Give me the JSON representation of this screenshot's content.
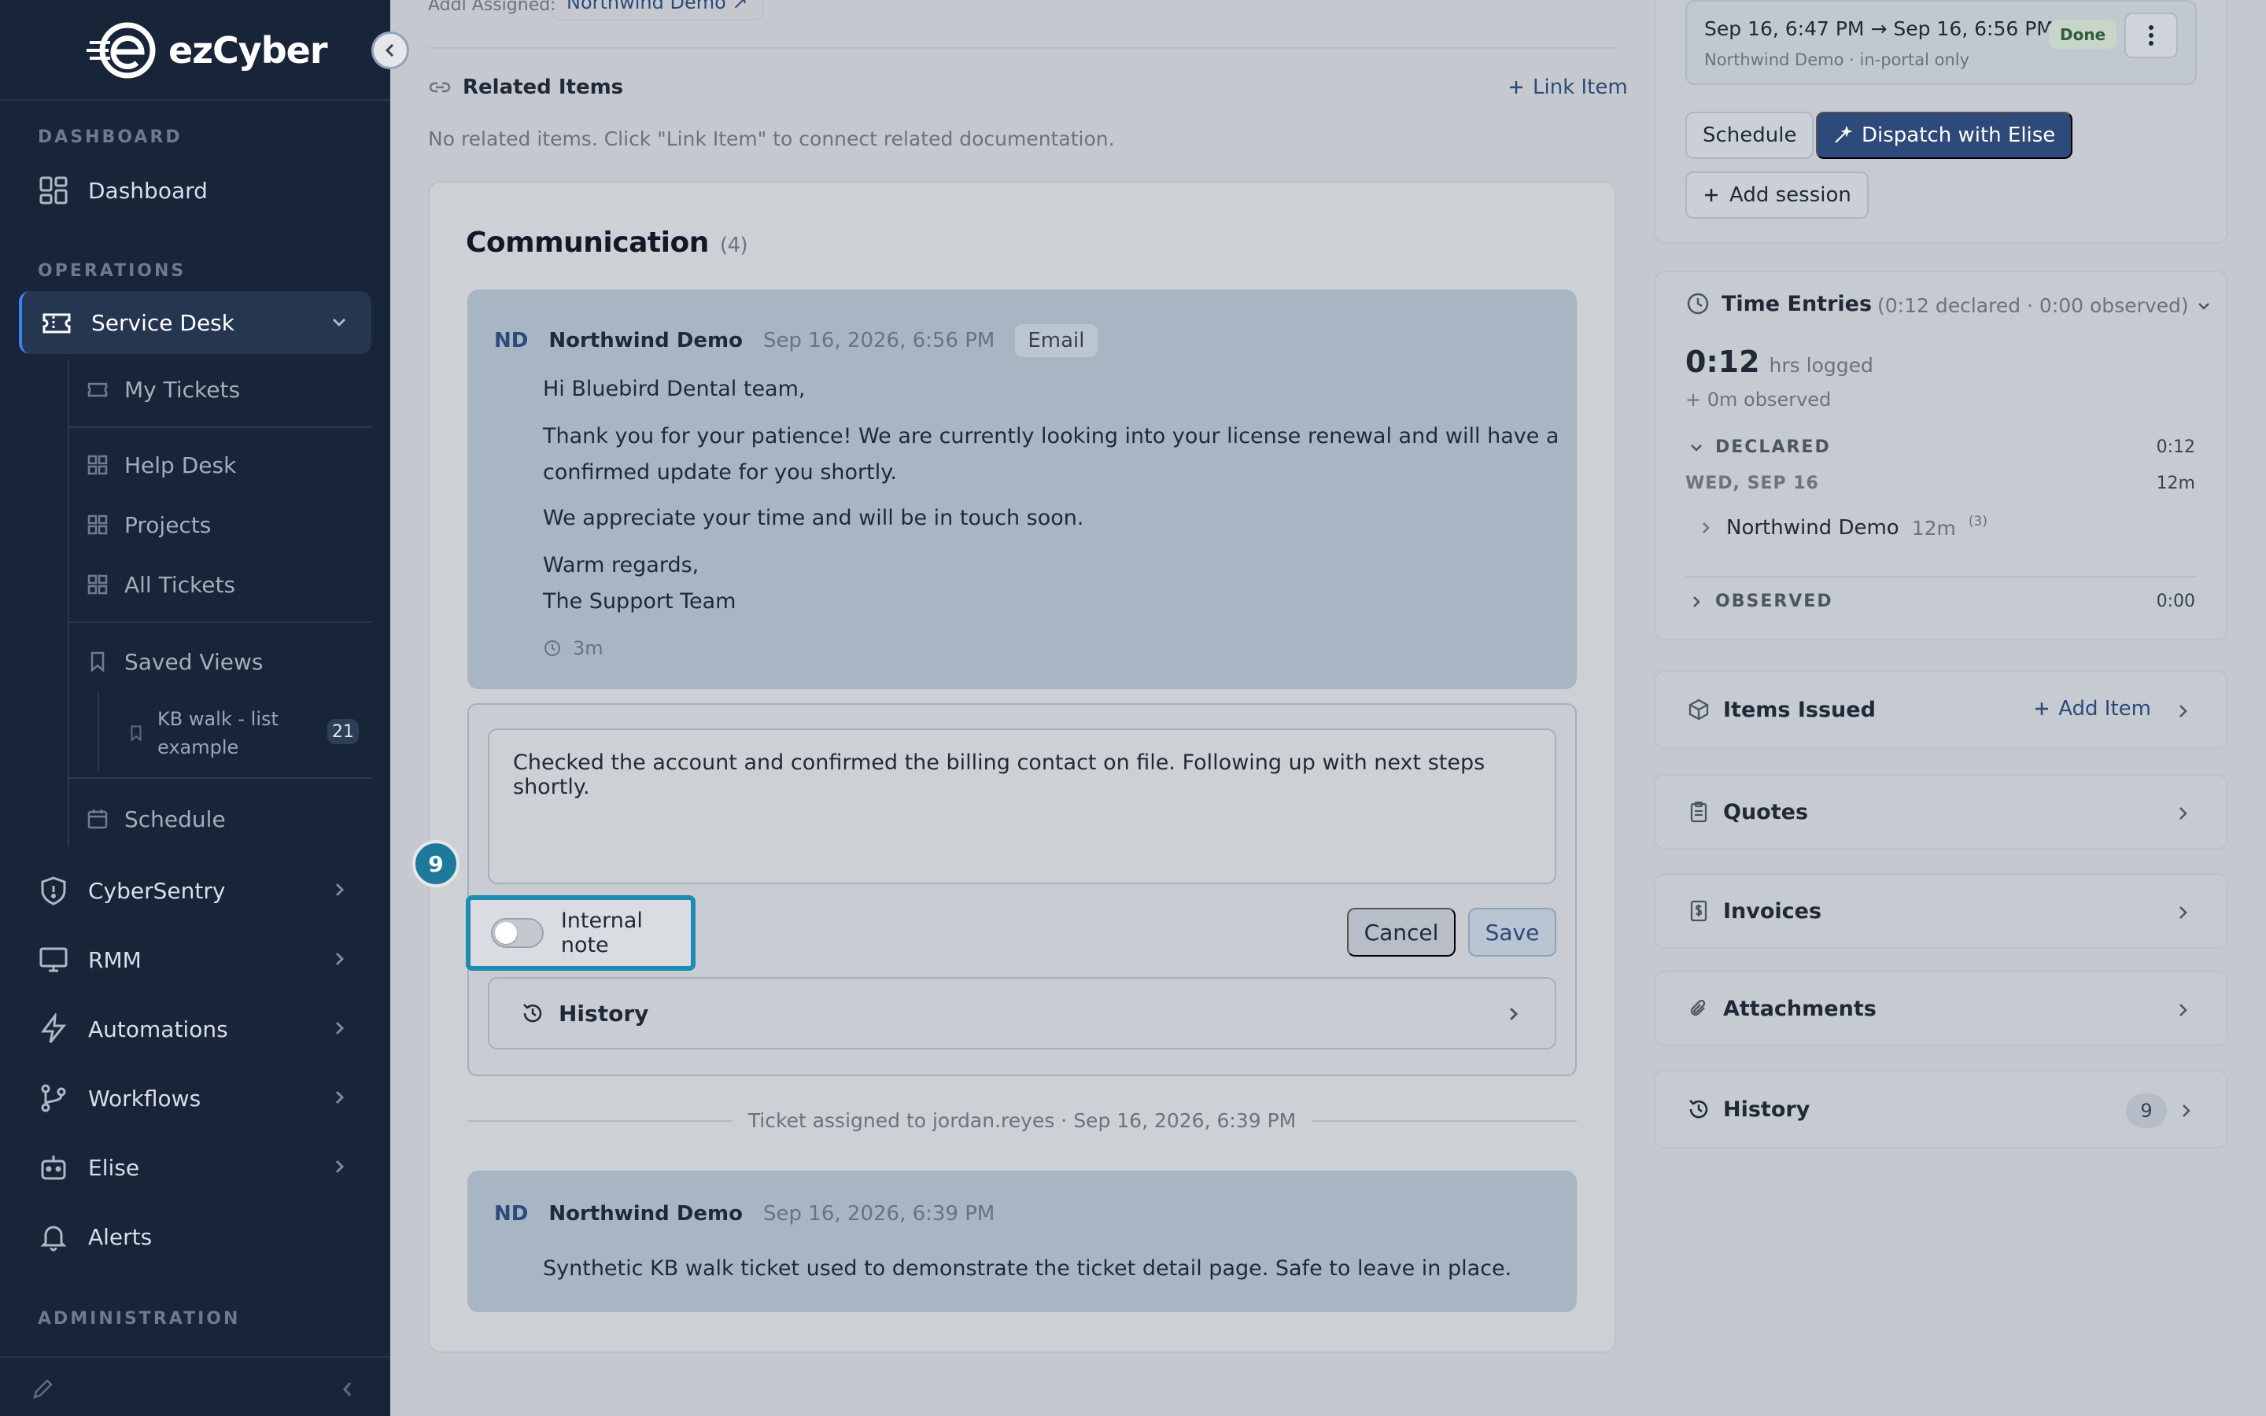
{
  "brand": {
    "logo_text": "ezCyber"
  },
  "sidebar": {
    "sections": {
      "dashboard": "DASHBOARD",
      "operations": "OPERATIONS",
      "administration": "ADMINISTRATION"
    },
    "items": {
      "dashboard": "Dashboard",
      "service_desk": "Service Desk",
      "cybersentry": "CyberSentry",
      "rmm": "RMM",
      "automations": "Automations",
      "workflows": "Workflows",
      "elise": "Elise",
      "alerts": "Alerts"
    },
    "sub_items": {
      "my_tickets": "My Tickets",
      "help_desk": "Help Desk",
      "projects": "Projects",
      "all_tickets": "All Tickets",
      "saved_views": "Saved Views",
      "saved_view_1": "KB walk - list example",
      "saved_view_1_count": "21",
      "schedule": "Schedule"
    }
  },
  "top": {
    "assigned_label": "Addl Assigned:",
    "assigned_value": "Northwind Demo ↗"
  },
  "related": {
    "title": "Related Items",
    "link_label": "Link Item",
    "empty_text": "No related items. Click \"Link Item\" to connect related documentation."
  },
  "communication": {
    "title": "Communication",
    "count": "(4)",
    "messages": [
      {
        "initials": "ND",
        "author": "Northwind Demo",
        "time": "Sep 16, 2026, 6:56 PM",
        "tag": "Email",
        "lines": [
          "Hi Bluebird Dental team,",
          "Thank you for your patience! We are currently looking into your license renewal and will have a",
          "confirmed update for you shortly.",
          "We appreciate your time and will be in touch soon.",
          "Warm regards,",
          "The Support Team"
        ],
        "duration": "3m"
      },
      {
        "initials": "ND",
        "author": "Northwind Demo",
        "time": "Sep 16, 2026, 6:39 PM",
        "body": "Synthetic KB walk ticket used to demonstrate the ticket detail page. Safe to leave in place."
      }
    ],
    "reply": {
      "text": "Checked the account and confirmed the billing contact on file. Following up with next steps shortly.",
      "internal_note_label": "Internal note",
      "internal_note_on": false,
      "cancel_label": "Cancel",
      "save_label": "Save",
      "history_label": "History"
    },
    "step_badge": "9",
    "system_event": "Ticket assigned to jordan.reyes · Sep 16, 2026, 6:39 PM"
  },
  "right": {
    "session": {
      "time_range": "Sep 16, 6:47 PM → Sep 16, 6:56 PM",
      "sub": "Northwind Demo · in-portal only",
      "status": "Done"
    },
    "buttons": {
      "schedule": "Schedule",
      "dispatch": "Dispatch with Elise",
      "add_session": "Add session"
    },
    "time_entries": {
      "title": "Time Entries",
      "summary": "(0:12 declared · 0:00 observed)",
      "total": "0:12",
      "total_unit": "hrs logged",
      "observed_note": "+ 0m observed",
      "declared_label": "DECLARED",
      "declared_value": "0:12",
      "date_label": "WED, SEP 16",
      "date_value": "12m",
      "entry_name": "Northwind Demo",
      "entry_duration": "12m",
      "entry_count": "(3)",
      "observed_label": "OBSERVED",
      "observed_value": "0:00"
    },
    "sections": {
      "items_issued": "Items Issued",
      "add_item": "Add Item",
      "quotes": "Quotes",
      "invoices": "Invoices",
      "attachments": "Attachments",
      "history": "History",
      "history_count": "9"
    }
  },
  "colors": {
    "sidebar_bg": "#182438",
    "accent": "#2d4a7a",
    "highlight": "#1d8cb0"
  }
}
